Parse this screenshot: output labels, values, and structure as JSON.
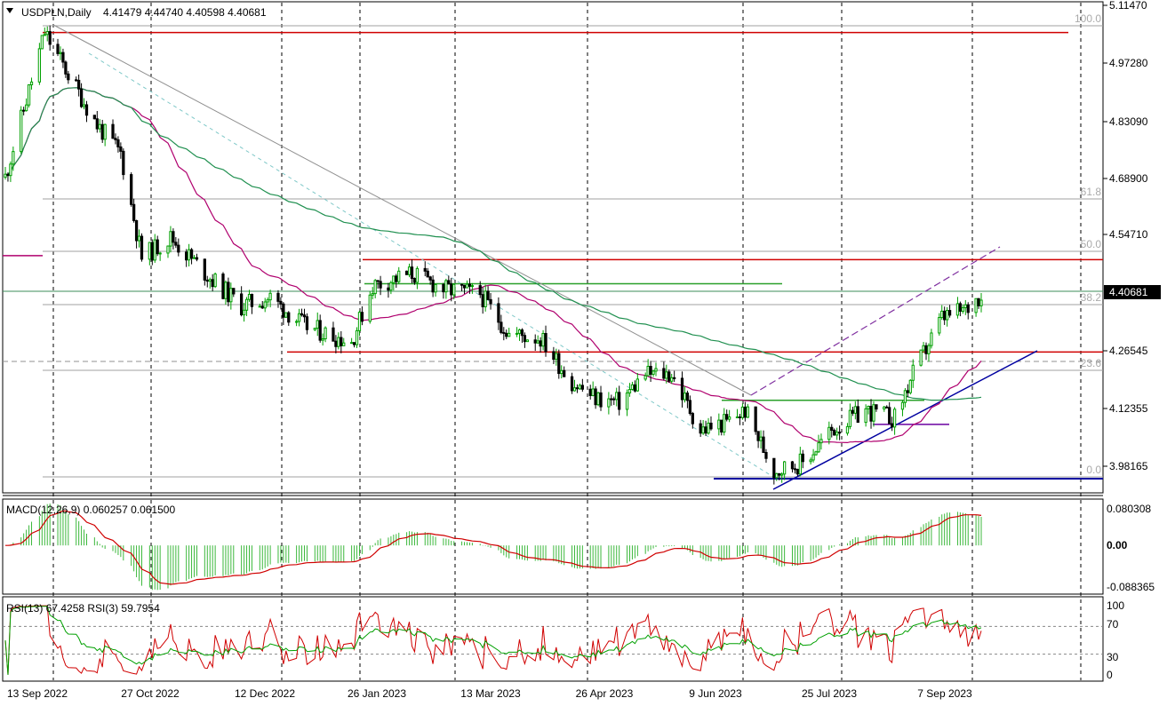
{
  "header": {
    "symbol": "USDPLN,Daily",
    "ohlc": "4.41479 4.44740 4.40598 4.40681"
  },
  "price_axis": {
    "ticks": [
      "5.11470",
      "4.97280",
      "4.83090",
      "4.68900",
      "4.54710",
      "4.40681",
      "4.26545",
      "4.12355",
      "3.98165"
    ],
    "current_price": "4.40681"
  },
  "fib_levels": [
    "100.0",
    "61.8",
    "50.0",
    "38.2",
    "23.6",
    "0.0"
  ],
  "macd": {
    "label": "MACD(12,26,9) 0.060257 0.061500",
    "ticks": [
      "0.080308",
      "0.00",
      "-0.088365"
    ]
  },
  "rsi": {
    "label": "RSI(13) 67.4258  RSI(3) 59.7954",
    "ticks": [
      "100",
      "70",
      "30",
      "0"
    ]
  },
  "date_labels": [
    "13 Sep 2022",
    "27 Oct 2022",
    "12 Dec 2022",
    "26 Jan 2023",
    "13 Mar 2023",
    "26 Apr 2023",
    "9 Jun 2023",
    "25 Jul 2023",
    "7 Sep 2023"
  ],
  "colors": {
    "bull": "#00a000",
    "bear": "#000000",
    "ma_short": "#b0006e",
    "ma_long": "#209050",
    "macd_hist": "#3cb83c",
    "signal": "#d00000",
    "rsi13": "#00a000",
    "rsi3": "#d00000",
    "hline": "#d00000",
    "trend_blue": "#0000a0"
  },
  "chart_data": {
    "type": "candlestick",
    "symbol": "USDPLN",
    "timeframe": "Daily",
    "last_ohlc": {
      "open": 4.41479,
      "high": 4.4474,
      "low": 4.40598,
      "close": 4.40681
    },
    "ylim": [
      3.93,
      5.13
    ],
    "anchors": [
      {
        "x": "2022-09-13",
        "y": 4.7
      },
      {
        "x": "2022-09-28",
        "y": 5.06
      },
      {
        "x": "2022-10-18",
        "y": 4.83
      },
      {
        "x": "2022-10-27",
        "y": 4.76
      },
      {
        "x": "2022-11-04",
        "y": 4.5
      },
      {
        "x": "2022-11-15",
        "y": 4.55
      },
      {
        "x": "2022-11-30",
        "y": 4.45
      },
      {
        "x": "2022-12-12",
        "y": 4.38
      },
      {
        "x": "2022-12-23",
        "y": 4.4
      },
      {
        "x": "2023-01-05",
        "y": 4.33
      },
      {
        "x": "2023-01-23",
        "y": 4.29
      },
      {
        "x": "2023-01-31",
        "y": 4.43
      },
      {
        "x": "2023-02-15",
        "y": 4.46
      },
      {
        "x": "2023-02-28",
        "y": 4.42
      },
      {
        "x": "2023-03-13",
        "y": 4.41
      },
      {
        "x": "2023-03-24",
        "y": 4.31
      },
      {
        "x": "2023-04-05",
        "y": 4.3
      },
      {
        "x": "2023-04-17",
        "y": 4.19
      },
      {
        "x": "2023-04-26",
        "y": 4.15
      },
      {
        "x": "2023-05-05",
        "y": 4.14
      },
      {
        "x": "2023-05-15",
        "y": 4.21
      },
      {
        "x": "2023-05-25",
        "y": 4.21
      },
      {
        "x": "2023-06-05",
        "y": 4.07
      },
      {
        "x": "2023-06-15",
        "y": 4.09
      },
      {
        "x": "2023-06-22",
        "y": 4.12
      },
      {
        "x": "2023-07-03",
        "y": 3.97
      },
      {
        "x": "2023-07-14",
        "y": 3.99
      },
      {
        "x": "2023-07-25",
        "y": 4.07
      },
      {
        "x": "2023-08-07",
        "y": 4.12
      },
      {
        "x": "2023-08-18",
        "y": 4.1
      },
      {
        "x": "2023-08-25",
        "y": 4.21
      },
      {
        "x": "2023-09-05",
        "y": 4.35
      },
      {
        "x": "2023-09-14",
        "y": 4.37
      },
      {
        "x": "2023-09-20",
        "y": 4.41
      }
    ],
    "hlines": [
      {
        "y": 5.06,
        "color": "red"
      },
      {
        "y": 4.495,
        "color": "red"
      },
      {
        "y": 4.265,
        "color": "red"
      },
      {
        "y": 4.435,
        "color": "green"
      },
      {
        "y": 4.145,
        "color": "green"
      },
      {
        "y": 4.085,
        "color": "purple"
      },
      {
        "y": 3.95,
        "color": "blue"
      }
    ],
    "macd_range": [
      -0.1,
      0.095
    ],
    "rsi_range": [
      0,
      100
    ],
    "rsi_levels": [
      30,
      70
    ]
  }
}
